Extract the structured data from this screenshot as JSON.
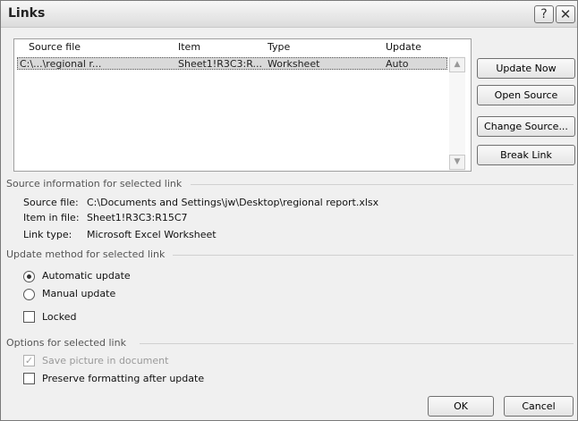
{
  "window": {
    "title": "Links",
    "help_glyph": "?",
    "close_glyph": "✕"
  },
  "list": {
    "columns": [
      "Source file",
      "Item",
      "Type",
      "Update"
    ],
    "rows": [
      {
        "source_file": "C:\\...\\regional r...",
        "item": "Sheet1!R3C3:R...",
        "type": "Worksheet",
        "update": "Auto"
      }
    ],
    "scroll_up_glyph": "▲",
    "scroll_down_glyph": "▼"
  },
  "buttons": {
    "update_now": "Update Now",
    "open_source": "Open Source",
    "change_source": "Change Source...",
    "break_link": "Break Link",
    "ok": "OK",
    "cancel": "Cancel"
  },
  "source_info": {
    "heading": "Source information for selected link",
    "source_file_label": "Source file:",
    "source_file_value": "C:\\Documents and Settings\\jw\\Desktop\\regional report.xlsx",
    "item_label": "Item in file:",
    "item_value": "Sheet1!R3C3:R15C7",
    "link_type_label": "Link type:",
    "link_type_value": "Microsoft Excel Worksheet"
  },
  "update_method": {
    "heading": "Update method for selected link",
    "automatic": "Automatic update",
    "automatic_selected": true,
    "manual": "Manual update",
    "locked": "Locked",
    "locked_checked": false
  },
  "options": {
    "heading": "Options for selected link",
    "save_picture": "Save picture in document",
    "save_picture_checked": true,
    "save_picture_enabled": false,
    "preserve_formatting": "Preserve formatting after update",
    "preserve_formatting_checked": false
  }
}
